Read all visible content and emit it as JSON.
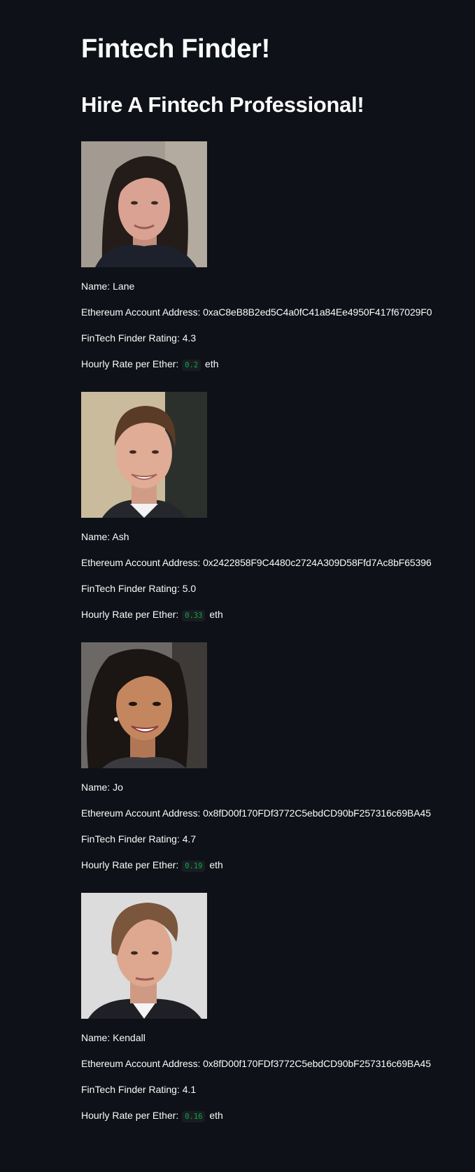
{
  "page": {
    "title": "Fintech Finder!",
    "subtitle": "Hire A Fintech Professional!"
  },
  "labels": {
    "name": "Name:",
    "address": "Ethereum Account Address:",
    "rating": "FinTech Finder Rating:",
    "rate": "Hourly Rate per Ether:",
    "unit": "eth"
  },
  "candidates": [
    {
      "name": "Lane",
      "address": "0xaC8eB8B2ed5C4a0fC41a84Ee4950F417f67029F0",
      "rating": "4.3",
      "rate": "0.2",
      "photo": "woman-curly-dark-hair-portrait"
    },
    {
      "name": "Ash",
      "address": "0x2422858F9C4480c2724A309D58Ffd7Ac8bF65396",
      "rating": "5.0",
      "rate": "0.33",
      "photo": "smiling-man-short-brown-hair-portrait"
    },
    {
      "name": "Jo",
      "address": "0x8fD00f170FDf3772C5ebdCD90bF257316c69BA45",
      "rating": "4.7",
      "rate": "0.19",
      "photo": "smiling-woman-dark-hair-portrait"
    },
    {
      "name": "Kendall",
      "address": "0x8fD00f170FDf3772C5ebdCD90bF257316c69BA45",
      "rating": "4.1",
      "rate": "0.16",
      "photo": "man-brown-hair-suit-portrait"
    }
  ],
  "colors": {
    "background": "#0e1117",
    "text": "#fafafa",
    "code_text": "#09ab3b",
    "code_background": "#1a1c24"
  }
}
